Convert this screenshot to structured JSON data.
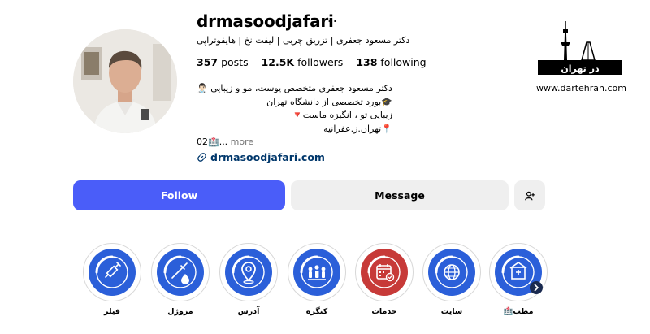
{
  "profile": {
    "username": "drmasoodjafari",
    "more_icon": "ellipsis-icon",
    "tagline": "دکتر مسعود جعفری | تزریق چربی | لیفت نخ | هایفوتراپی",
    "stats": {
      "posts_value": "357",
      "posts_label": "posts",
      "followers_value": "12.5K",
      "followers_label": "followers",
      "following_value": "138",
      "following_label": "following"
    },
    "bio": {
      "line1": "دکتر مسعود جعفری متخصص پوست، مو و زیبایی 👨🏻‍⚕️",
      "line2": "🎓بورد تخصصی از دانشگاه تهران",
      "line3": "زیبایی تو ، انگیزه ماست🔻",
      "line4": "📍تهران.ز.عفرانیه",
      "line5_prefix": "02🏥...",
      "line5_more": " more"
    },
    "link_text": "drmasoodjafari.com"
  },
  "actions": {
    "follow_label": "Follow",
    "message_label": "Message",
    "add_user_icon": "add-user-icon"
  },
  "brand": {
    "logo_text": "در تهران",
    "url": "www.dartehran.com"
  },
  "highlights": [
    {
      "label": "فیلر",
      "icon": "syringe-icon",
      "color": "#2b5fd9"
    },
    {
      "label": "مزوژل",
      "icon": "mesogel-icon",
      "color": "#2b5fd9"
    },
    {
      "label": "آدرس",
      "icon": "location-pin-icon",
      "color": "#2b5fd9"
    },
    {
      "label": "کنگره",
      "icon": "congress-icon",
      "color": "#2b5fd9"
    },
    {
      "label": "خدمات",
      "icon": "calendar-check-icon",
      "color": "#c73a38"
    },
    {
      "label": "سایت",
      "icon": "globe-icon",
      "color": "#2b5fd9"
    },
    {
      "label": "مطب🏥",
      "icon": "clinic-icon",
      "color": "#2b5fd9"
    }
  ],
  "colors": {
    "follow": "#4a5df9",
    "secondary_button": "#efefef",
    "link": "#00376b"
  }
}
